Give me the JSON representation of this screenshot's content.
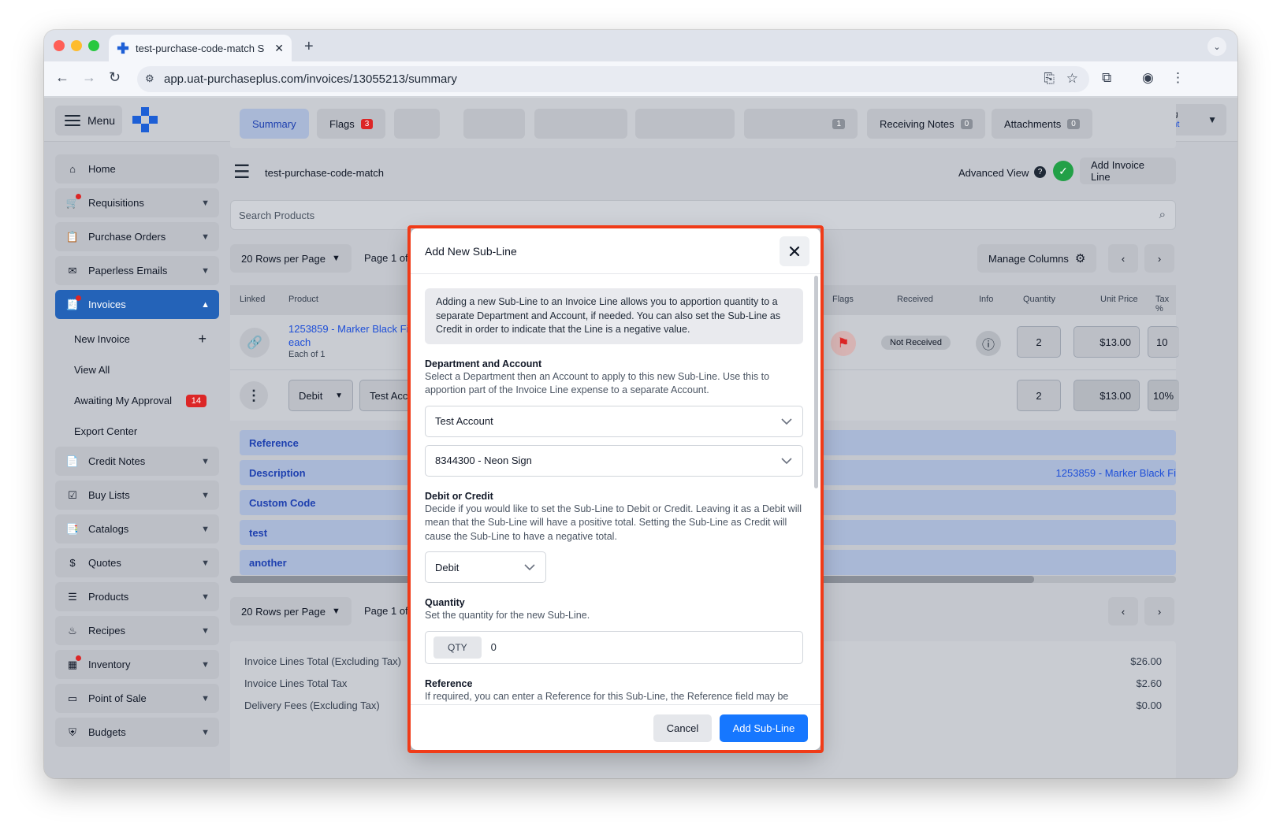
{
  "browser": {
    "tab_title": "test-purchase-code-match S",
    "url": "app.uat-purchaseplus.com/invoices/13055213/summary"
  },
  "header": {
    "menu_label": "Menu",
    "user_name": "Harry Balding",
    "user_account": "Test Account"
  },
  "sidebar": {
    "items": [
      {
        "label": "Home",
        "icon": "home-icon"
      },
      {
        "label": "Requisitions",
        "icon": "cart-icon"
      },
      {
        "label": "Purchase Orders",
        "icon": "clipboard-icon"
      },
      {
        "label": "Paperless Emails",
        "icon": "mail-icon"
      },
      {
        "label": "Invoices",
        "icon": "invoice-icon"
      },
      {
        "label": "Credit Notes",
        "icon": "document-icon"
      },
      {
        "label": "Buy Lists",
        "icon": "checklist-icon"
      },
      {
        "label": "Catalogs",
        "icon": "catalog-icon"
      },
      {
        "label": "Quotes",
        "icon": "dollar-icon"
      },
      {
        "label": "Products",
        "icon": "box-icon"
      },
      {
        "label": "Recipes",
        "icon": "recipe-icon"
      },
      {
        "label": "Inventory",
        "icon": "inventory-icon"
      },
      {
        "label": "Point of Sale",
        "icon": "pos-icon"
      },
      {
        "label": "Budgets",
        "icon": "budget-icon"
      }
    ],
    "invoice_sub": {
      "new_invoice": "New Invoice",
      "view_all": "View All",
      "awaiting": "Awaiting My Approval",
      "awaiting_count": "14",
      "export": "Export Center"
    }
  },
  "tabs": {
    "summary": "Summary",
    "flags": "Flags",
    "flags_count": "3",
    "hidden_count": "1",
    "receiving_notes": "Receiving Notes",
    "receiving_count": "0",
    "attachments": "Attachments",
    "attachments_count": "0"
  },
  "invoice": {
    "name": "test-purchase-code-match",
    "advanced_view": "Advanced View",
    "add_line": "Add Invoice Line",
    "search_placeholder": "Search Products",
    "rows_per_page": "20 Rows per Page",
    "page_info": "Page 1 of",
    "manage_columns": "Manage Columns",
    "columns": {
      "linked": "Linked",
      "product": "Product",
      "flags": "Flags",
      "received": "Received",
      "info": "Info",
      "quantity": "Quantity",
      "unit_price": "Unit Price",
      "tax": "Tax %"
    },
    "line": {
      "product": "1253859 - Marker Black Fi",
      "product_unit": "each",
      "each_of": "Each of 1",
      "status": "Not Received",
      "quantity": "2",
      "unit_price": "$13.00",
      "tax": "10"
    },
    "subline": {
      "debit": "Debit",
      "account": "Test Acc",
      "quantity": "2",
      "unit_price": "$13.00",
      "tax": "10%"
    },
    "sub_rows": [
      "Reference",
      "Description",
      "Custom Code",
      "test",
      "another"
    ],
    "description_value": "1253859 - Marker Black Fi",
    "totals": [
      {
        "label": "Invoice Lines Total (Excluding Tax)",
        "value": "$26.00"
      },
      {
        "label": "Invoice Lines Total Tax",
        "value": "$2.60"
      },
      {
        "label": "Delivery Fees (Excluding Tax)",
        "value": "$0.00"
      }
    ]
  },
  "modal": {
    "title": "Add New Sub-Line",
    "info": "Adding a new Sub-Line to an Invoice Line allows you to apportion quantity to a separate Department and Account, if needed. You can also set the Sub-Line as Credit in order to indicate that the Line is a negative value.",
    "dept_title": "Department and Account",
    "dept_desc": "Select a Department then an Account to apply to this new Sub-Line. Use this to apportion part of the Invoice Line expense to a separate Account.",
    "department_value": "Test Account",
    "account_value": "8344300 - Neon Sign",
    "dc_title": "Debit or Credit",
    "dc_desc": "Decide if you would like to set the Sub-Line to Debit or Credit. Leaving it as a Debit will mean that the Sub-Line will have a positive total. Setting the Sub-Line as Credit will cause the Sub-Line to have a negative total.",
    "dc_value": "Debit",
    "qty_title": "Quantity",
    "qty_desc": "Set the quantity for the new Sub-Line.",
    "qty_tag": "QTY",
    "qty_value": "0",
    "ref_title": "Reference",
    "ref_desc": "If required, you can enter a Reference for this Sub-Line, the Reference field may be used by your Organisation in your Invoice Export files.",
    "cancel": "Cancel",
    "submit": "Add Sub-Line"
  },
  "colors": {
    "accent": "#1677ff",
    "highlight": "#f03b18",
    "sidebar_active": "#2463b8"
  }
}
